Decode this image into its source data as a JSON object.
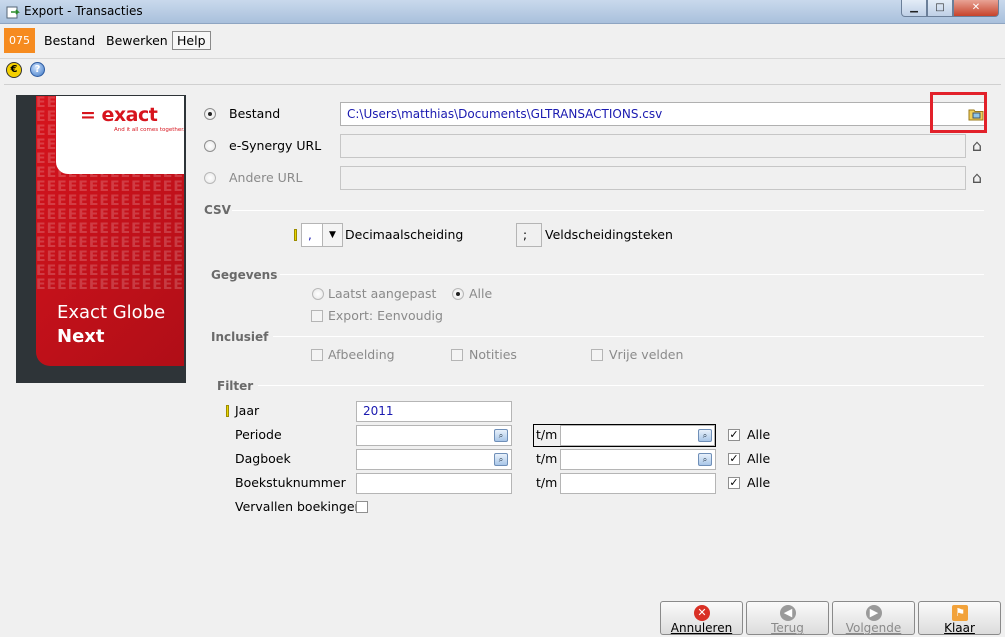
{
  "window": {
    "title": "Export - Transacties",
    "minimize_glyph": "▁",
    "maximize_glyph": "□",
    "close_glyph": "✕"
  },
  "menu": {
    "app_code": "075",
    "items": [
      "Bestand",
      "Bewerken",
      "Help"
    ]
  },
  "toolbar": {
    "euro_icon_glyph": "€",
    "help_icon_glyph": "?"
  },
  "branding": {
    "logo": "= exact",
    "tagline": "And it all comes together.",
    "product_line1": "Exact Globe",
    "product_line2": "Next",
    "pattern": "EEEEEEEEEEEEEEEEEEEEEEEEEEEEEEEEEEEEEEEEEEEEEEEEEEEEEEEEEEEEEEEEEEEEEEEEEEEEEEEEEEEEEEEEEEEEEEEEEEEEEEEEEEEEEEEEEEEEEEEEEEEEEEEEEEEEEEEEEEEEEEEEEEEEEEEEEEEEEEEEEEEEEEEEEEEEEEEEEEEEEEEEEEEEEEEEEEEE"
  },
  "source": {
    "bestand_label": "Bestand",
    "bestand_value": "C:\\Users\\matthias\\Documents\\GLTRANSACTIONS.csv",
    "esynergy_label": "e-Synergy URL",
    "andere_label": "Andere URL",
    "selected": "Bestand"
  },
  "csv": {
    "section": "CSV",
    "decimal_value": ",",
    "decimal_label": "Decimaalscheiding",
    "separator_value": ";",
    "separator_label": "Veldscheidingsteken"
  },
  "gegevens": {
    "section": "Gegevens",
    "option1": "Laatst aangepast",
    "option2": "Alle",
    "export_simple": "Export: Eenvoudig"
  },
  "inclusief": {
    "section": "Inclusief",
    "items": [
      "Afbeelding",
      "Notities",
      "Vrije velden"
    ]
  },
  "filter": {
    "section": "Filter",
    "jaar_label": "Jaar",
    "jaar_value": "2011",
    "periode_label": "Periode",
    "dagboek_label": "Dagboek",
    "boekstuk_label": "Boekstuknummer",
    "vervallen_label": "Vervallen boekingen",
    "tm": "t/m",
    "alle": "Alle"
  },
  "buttons": {
    "annuleren": "Annuleren",
    "terug": "Terug",
    "volgende": "Volgende",
    "klaar": "Klaar"
  },
  "colors": {
    "accent": "#f68b1f",
    "brand_red": "#d7141d",
    "highlight_box": "#e2212a"
  }
}
